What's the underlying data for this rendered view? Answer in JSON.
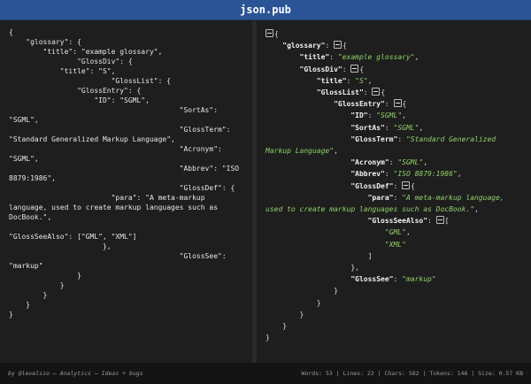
{
  "header": {
    "title": "json.pub"
  },
  "left": {
    "lines": [
      "{",
      "    \"glossary\": {",
      "        \"title\": \"example glossary\",",
      "                \"GlossDiv\": {",
      "            \"title\": \"S\",",
      "                        \"GlossList\": {",
      "                \"GlossEntry\": {",
      "                    \"ID\": \"SGML\",",
      "                                        \"SortAs\":",
      "\"SGML\",",
      "                                        \"GlossTerm\":",
      "\"Standard Generalized Markup Language\",",
      "                                        \"Acronym\":",
      "\"SGML\",",
      "                                        \"Abbrev\": \"ISO",
      "8879:1986\",",
      "                                        \"GlossDef\": {",
      "                        \"para\": \"A meta-markup",
      "language, used to create markup languages such as",
      "DocBook.\",",
      "",
      "\"GlossSeeAlso\": [\"GML\", \"XML\"]",
      "                      },",
      "                                        \"GlossSee\":",
      "\"markup\"",
      "                }",
      "            }",
      "        }",
      "    }",
      "}"
    ]
  },
  "tree": {
    "lines": [
      {
        "i": 0,
        "o": "{"
      },
      {
        "i": 1,
        "k": "glossary",
        "o": "{"
      },
      {
        "i": 2,
        "k": "title",
        "s": "example glossary",
        "c": ","
      },
      {
        "i": 2,
        "k": "GlossDiv",
        "o": "{"
      },
      {
        "i": 3,
        "k": "title",
        "s": "S",
        "c": ","
      },
      {
        "i": 3,
        "k": "GlossList",
        "o": "{"
      },
      {
        "i": 4,
        "k": "GlossEntry",
        "o": "{"
      },
      {
        "i": 5,
        "k": "ID",
        "s": "SGML",
        "c": ","
      },
      {
        "i": 5,
        "k": "SortAs",
        "s": "SGML",
        "c": ","
      },
      {
        "i": 5,
        "k": "GlossTerm",
        "s": "Standard Generalized Markup Language",
        "c": ","
      },
      {
        "i": 5,
        "k": "Acronym",
        "s": "SGML",
        "c": ","
      },
      {
        "i": 5,
        "k": "Abbrev",
        "s": "ISO 8879:1986",
        "c": ","
      },
      {
        "i": 5,
        "k": "GlossDef",
        "o": "{"
      },
      {
        "i": 6,
        "k": "para",
        "s": "A meta-markup language, used to create markup languages such as DocBook.",
        "c": ","
      },
      {
        "i": 6,
        "k": "GlossSeeAlso",
        "o": "["
      },
      {
        "i": 7,
        "s": "GML",
        "c": ","
      },
      {
        "i": 7,
        "s": "XML"
      },
      {
        "i": 6,
        "p": "]"
      },
      {
        "i": 5,
        "p": "},"
      },
      {
        "i": 5,
        "k": "GlossSee",
        "s": "markup"
      },
      {
        "i": 4,
        "p": "}"
      },
      {
        "i": 3,
        "p": "}"
      },
      {
        "i": 2,
        "p": "}"
      },
      {
        "i": 1,
        "p": "}"
      },
      {
        "i": 0,
        "p": "}"
      }
    ]
  },
  "footer": {
    "credits": "by @levelsio – Analytics – Ideas + bugs",
    "stats": "Words: 53 | Lines: 22 | Chars: 582 | Tokens: 146 | Size: 0.57 KB"
  },
  "colors": {
    "header": "#2b5496",
    "string": "#8fd16a",
    "background": "#1e1e1e"
  }
}
